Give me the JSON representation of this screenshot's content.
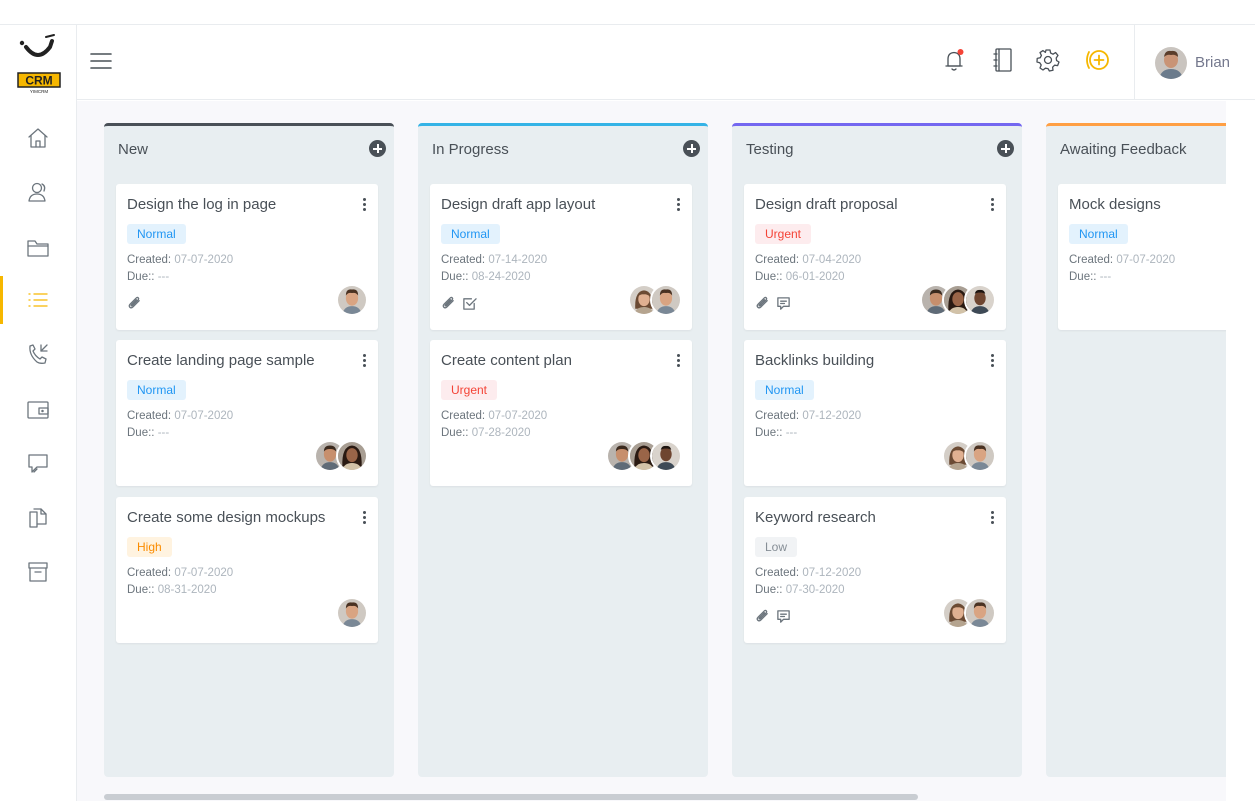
{
  "brand": {
    "logo_text": "CRM",
    "logo_sub": "YIMCRM"
  },
  "user": {
    "name": "Brian"
  },
  "sidebar": {
    "items": [
      {
        "name": "home-icon"
      },
      {
        "name": "contacts-icon"
      },
      {
        "name": "folder-icon"
      },
      {
        "name": "task-list-icon",
        "active": true
      },
      {
        "name": "phone-call-icon"
      },
      {
        "name": "wallet-icon"
      },
      {
        "name": "chat-icon"
      },
      {
        "name": "documents-icon"
      },
      {
        "name": "archive-icon"
      }
    ]
  },
  "header": {
    "icons": [
      "bell-icon",
      "notebook-icon",
      "gear-icon",
      "add-circle-icon"
    ],
    "accent": "#f6b700"
  },
  "labels": {
    "created": "Created:",
    "due": "Due::"
  },
  "columns": [
    {
      "title": "New",
      "color": "#495057",
      "cards": [
        {
          "title": "Design the log in page",
          "priority": "Normal",
          "created": "07-07-2020",
          "due": "---",
          "attachments": true,
          "checklist": false,
          "comments": false,
          "avatars": [
            "man1"
          ]
        },
        {
          "title": "Create landing page sample",
          "priority": "Normal",
          "created": "07-07-2020",
          "due": "---",
          "attachments": false,
          "checklist": false,
          "comments": false,
          "avatars": [
            "man2",
            "woman2"
          ]
        },
        {
          "title": "Create some design mockups",
          "priority": "High",
          "created": "07-07-2020",
          "due": "08-31-2020",
          "attachments": false,
          "checklist": false,
          "comments": false,
          "avatars": [
            "man1"
          ]
        }
      ]
    },
    {
      "title": "In Progress",
      "color": "#34b3e6",
      "cards": [
        {
          "title": "Design draft app layout",
          "priority": "Normal",
          "created": "07-14-2020",
          "due": "08-24-2020",
          "attachments": true,
          "checklist": true,
          "comments": false,
          "avatars": [
            "woman1",
            "man1"
          ]
        },
        {
          "title": "Create content plan",
          "priority": "Urgent",
          "created": "07-07-2020",
          "due": "07-28-2020",
          "attachments": false,
          "checklist": false,
          "comments": false,
          "avatars": [
            "man2",
            "woman2",
            "man3"
          ]
        }
      ]
    },
    {
      "title": "Testing",
      "color": "#7367f0",
      "cards": [
        {
          "title": "Design draft proposal",
          "priority": "Urgent",
          "created": "07-04-2020",
          "due": "06-01-2020",
          "attachments": true,
          "checklist": false,
          "comments": true,
          "avatars": [
            "man2",
            "woman2",
            "man3"
          ]
        },
        {
          "title": "Backlinks building",
          "priority": "Normal",
          "created": "07-12-2020",
          "due": "---",
          "attachments": false,
          "checklist": false,
          "comments": false,
          "avatars": [
            "woman1",
            "man1"
          ]
        },
        {
          "title": "Keyword research",
          "priority": "Low",
          "created": "07-12-2020",
          "due": "07-30-2020",
          "attachments": true,
          "checklist": false,
          "comments": true,
          "avatars": [
            "woman1",
            "man1"
          ]
        }
      ]
    },
    {
      "title": "Awaiting Feedback",
      "color": "#ff9f43",
      "cards": [
        {
          "title": "Mock designs",
          "priority": "Normal",
          "created": "07-07-2020",
          "due": "---",
          "attachments": false,
          "checklist": false,
          "comments": false,
          "avatars": []
        }
      ]
    }
  ]
}
